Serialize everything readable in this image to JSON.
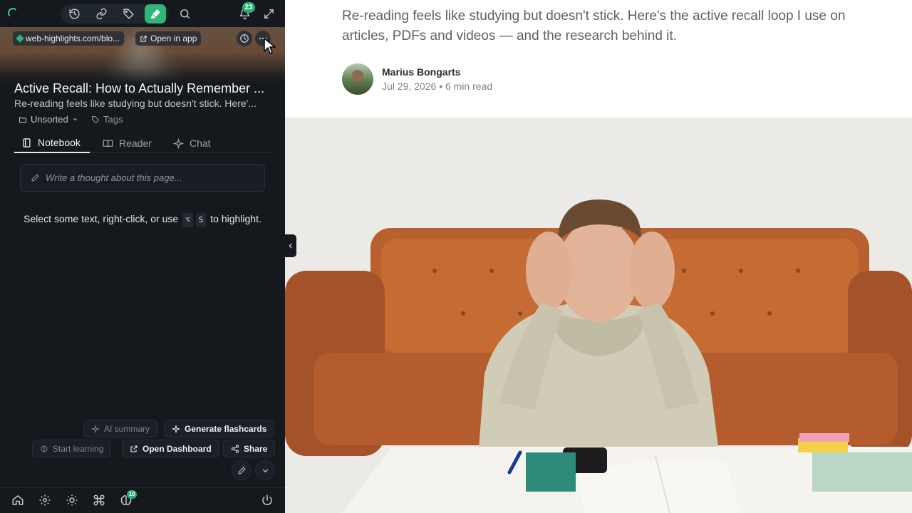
{
  "sidebar": {
    "toolbar": {
      "history_icon": "history-icon",
      "link_icon": "link-icon",
      "tag_icon": "tag-icon",
      "highlighter_icon": "highlighter-icon",
      "search_icon": "search-icon",
      "notification_count": "23",
      "expand_icon": "expand-icon",
      "accent_color": "#2fb67b"
    },
    "source_url": "web-highlights.com/blo...",
    "open_in_app": "Open in app",
    "title": "Active Recall: How to Actually Remember ...",
    "subtitle": "Re-reading feels like studying but doesn't stick. Here'...",
    "folder": "Unsorted",
    "tags": "Tags",
    "tabs": [
      {
        "label": "Notebook",
        "icon": "notebook-icon",
        "active": true
      },
      {
        "label": "Reader",
        "icon": "book-icon",
        "active": false
      },
      {
        "label": "Chat",
        "icon": "sparkle-icon",
        "active": false
      }
    ],
    "thought_placeholder": "Write a thought about this page...",
    "hint_before": "Select some text, right-click, or use",
    "hint_key1": "⌥",
    "hint_key2": "S",
    "hint_after": "to highlight.",
    "actions": {
      "ai_summary": "AI summary",
      "generate_flashcards": "Generate flashcards",
      "start_learning": "Start learning",
      "open_dashboard": "Open Dashboard",
      "share": "Share"
    },
    "bottom_bar": {
      "brain_badge": "10"
    }
  },
  "article": {
    "lede": "Re-reading feels like studying but doesn't stick. Here's the active recall loop I use on articles, PDFs and videos — and the research behind it.",
    "author": "Marius Bongarts",
    "date": "Jul 29, 2026",
    "separator": "•",
    "read_time": "6 min read"
  }
}
